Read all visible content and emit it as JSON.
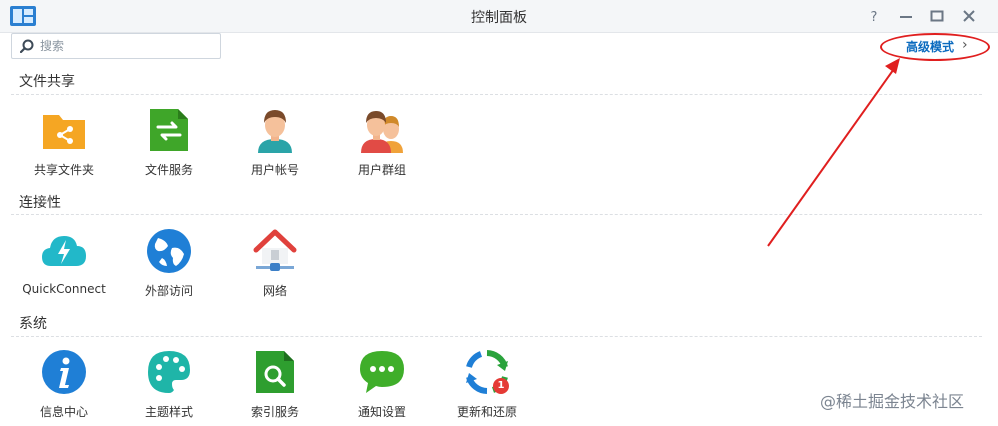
{
  "window": {
    "title": "控制面板",
    "buttons": [
      "help-icon",
      "minimize-icon",
      "maximize-icon",
      "close-icon"
    ]
  },
  "search": {
    "placeholder": "搜索",
    "value": ""
  },
  "advanced_mode": {
    "label": "高级模式",
    "chevron": "›"
  },
  "sections": [
    {
      "title": "文件共享",
      "items": [
        {
          "label": "共享文件夹",
          "icon": "shared-folder-icon"
        },
        {
          "label": "文件服务",
          "icon": "file-services-icon"
        },
        {
          "label": "用户帐号",
          "icon": "user-icon"
        },
        {
          "label": "用户群组",
          "icon": "group-icon"
        }
      ]
    },
    {
      "title": "连接性",
      "items": [
        {
          "label": "QuickConnect",
          "icon": "quickconnect-icon"
        },
        {
          "label": "外部访问",
          "icon": "external-access-icon"
        },
        {
          "label": "网络",
          "icon": "network-icon"
        }
      ]
    },
    {
      "title": "系统",
      "items": [
        {
          "label": "信息中心",
          "icon": "info-center-icon"
        },
        {
          "label": "主题样式",
          "icon": "theme-icon"
        },
        {
          "label": "索引服务",
          "icon": "indexing-service-icon"
        },
        {
          "label": "通知设置",
          "icon": "notification-icon"
        },
        {
          "label": "更新和还原",
          "icon": "update-restore-icon",
          "badge": "1"
        }
      ]
    }
  ],
  "watermark": "@稀土掘金技术社区",
  "colors": {
    "accent": "#0b6bbf",
    "annotation": "#e01f1f"
  }
}
